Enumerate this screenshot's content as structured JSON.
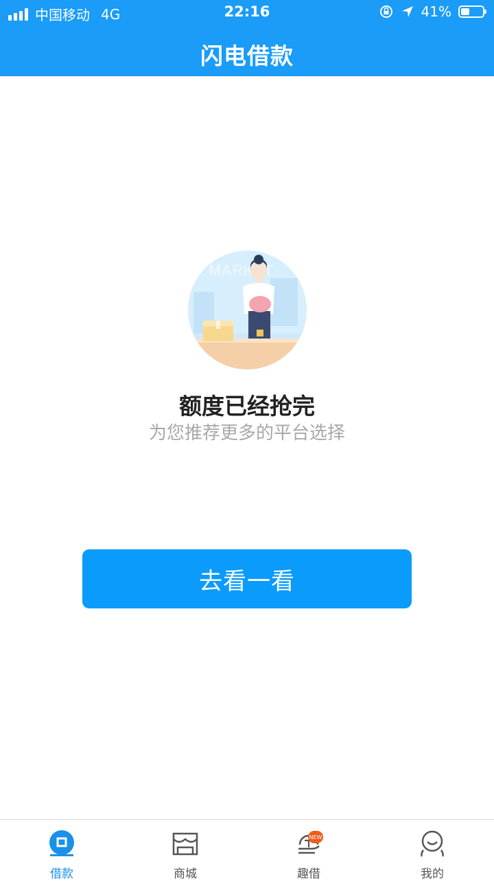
{
  "status_bar": {
    "carrier": "中国移动",
    "network": "4G",
    "time": "22:16",
    "battery": "41%",
    "battery_level": 0.41
  },
  "header": {
    "title": "闪电借款"
  },
  "main": {
    "message": "额度已经抢完",
    "submessage": "为您推荐更多的平台选择",
    "button_label": "去看一看",
    "illustration_text": "MARKET"
  },
  "tabbar": {
    "items": [
      {
        "label": "借款",
        "icon": "loan-icon",
        "active": true
      },
      {
        "label": "商城",
        "icon": "store-icon",
        "active": false
      },
      {
        "label": "趣借",
        "icon": "fun-loan-icon",
        "active": false,
        "badge": "NEW"
      },
      {
        "label": "我的",
        "icon": "profile-icon",
        "active": false
      }
    ]
  },
  "colors": {
    "primary": "#1a9cf8",
    "button": "#0b9bfb",
    "active_tab": "#1a90e8",
    "badge": "#f05a1a"
  }
}
